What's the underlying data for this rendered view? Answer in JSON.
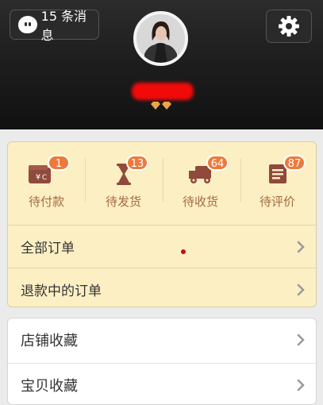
{
  "header": {
    "messages_label": "15 条消息",
    "message_icon": "chat-bubble-icon",
    "settings_icon": "gear-icon",
    "username": "",
    "level_badge": "diamond-icon"
  },
  "orders": {
    "statuses": [
      {
        "label": "待付款",
        "badge": "1",
        "icon": "wallet-icon"
      },
      {
        "label": "待发货",
        "badge": "13",
        "icon": "hourglass-icon"
      },
      {
        "label": "待收货",
        "badge": "64",
        "icon": "truck-icon"
      },
      {
        "label": "待评价",
        "badge": "87",
        "icon": "review-icon"
      }
    ],
    "all_orders_label": "全部订单",
    "refund_orders_label": "退款中的订单"
  },
  "favorites": {
    "shop_label": "店铺收藏",
    "item_label": "宝贝收藏"
  },
  "colors": {
    "accent_badge": "#ed7a3a",
    "status_label": "#a66a42",
    "panel_bg": "#fcefc4"
  }
}
